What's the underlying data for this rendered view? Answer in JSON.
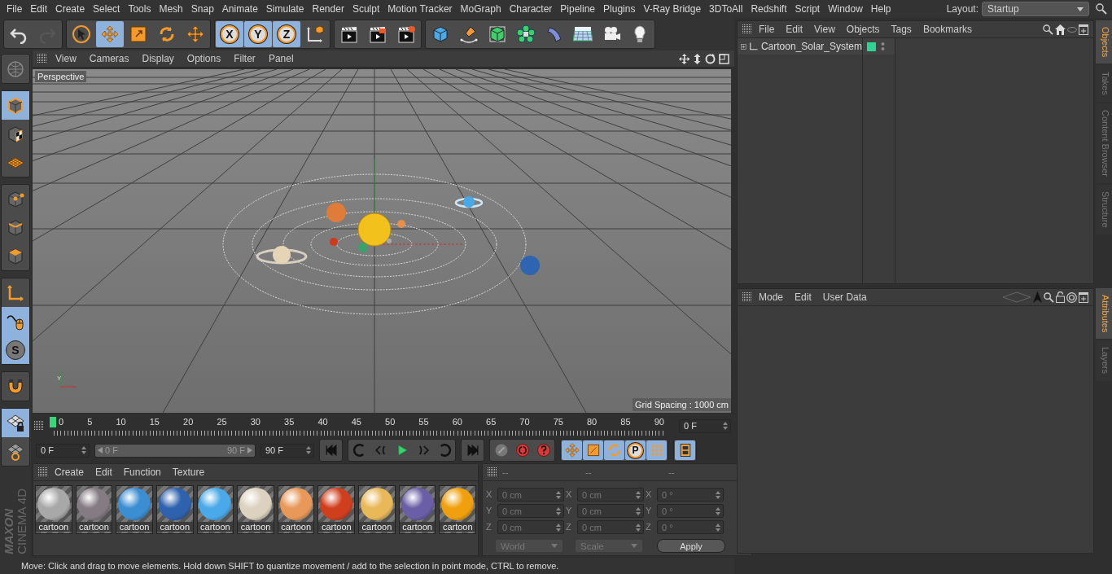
{
  "menubar": {
    "items": [
      "File",
      "Edit",
      "Create",
      "Select",
      "Tools",
      "Mesh",
      "Snap",
      "Animate",
      "Simulate",
      "Render",
      "Sculpt",
      "Motion Tracker",
      "MoGraph",
      "Character",
      "Pipeline",
      "Plugins",
      "V-Ray Bridge",
      "3DToAll",
      "Redshift",
      "Script",
      "Window",
      "Help"
    ],
    "layout_label": "Layout:",
    "layout_value": "Startup"
  },
  "toolbar": {
    "groups": [
      [
        {
          "selected": false,
          "disabled": false
        },
        {
          "selected": false,
          "disabled": true
        }
      ],
      [
        {
          "selected": false,
          "disabled": false
        },
        {
          "selected": true,
          "disabled": false
        },
        {
          "selected": false,
          "disabled": false
        },
        {
          "selected": false,
          "disabled": false
        },
        {
          "selected": false,
          "disabled": false
        }
      ],
      [
        {
          "label": "X",
          "selected": true,
          "disabled": false
        },
        {
          "label": "Y",
          "selected": true,
          "disabled": false
        },
        {
          "label": "Z",
          "selected": true,
          "disabled": false
        },
        {
          "selected": false,
          "disabled": false
        }
      ],
      [
        {
          "selected": false,
          "disabled": false
        },
        {
          "selected": false,
          "disabled": false
        },
        {
          "selected": false,
          "disabled": false
        }
      ],
      [
        {
          "selected": false,
          "disabled": false
        },
        {
          "selected": false,
          "disabled": false
        },
        {
          "selected": false,
          "disabled": false
        },
        {
          "selected": false,
          "disabled": false
        },
        {
          "selected": false,
          "disabled": false
        },
        {
          "selected": false,
          "disabled": false
        },
        {
          "selected": false,
          "disabled": false
        },
        {
          "selected": false,
          "disabled": false
        }
      ]
    ]
  },
  "left_toolbar": {
    "groups": [
      [
        {
          "selected": false
        }
      ],
      [
        {
          "selected": true
        },
        {
          "selected": false
        },
        {
          "selected": false
        }
      ],
      [
        {
          "selected": false
        },
        {
          "selected": false
        },
        {
          "selected": false
        }
      ],
      [
        {
          "selected": false
        },
        {
          "selected": true
        },
        {
          "label": "S",
          "selected": true
        }
      ],
      [
        {
          "selected": false
        }
      ],
      [
        {
          "selected": true
        },
        {
          "selected": false
        }
      ]
    ],
    "logo_brand": "MAXON",
    "logo_product": "CINEMA 4D"
  },
  "viewport": {
    "menu": [
      "View",
      "Cameras",
      "Display",
      "Options",
      "Filter",
      "Panel"
    ],
    "camera_label": "Perspective",
    "grid_spacing": "Grid Spacing : 1000 cm",
    "axis_label": "Y"
  },
  "timeline": {
    "ticks": [
      "0",
      "5",
      "10",
      "15",
      "20",
      "25",
      "30",
      "35",
      "40",
      "45",
      "50",
      "55",
      "60",
      "65",
      "70",
      "75",
      "80",
      "85",
      "90"
    ],
    "playhead": {
      "level": 0
    },
    "current_frame": "0 F"
  },
  "transport": {
    "start_field": "0 F",
    "range_start": "0 F",
    "range_end": "90 F",
    "range": {
      "level": 1
    },
    "end_field": "90 F",
    "groups": [
      [
        {
          "selected": false
        }
      ],
      [
        {
          "selected": false
        },
        {
          "selected": false
        },
        {
          "selected": false
        },
        {
          "selected": false
        },
        {
          "selected": false
        }
      ],
      [
        {
          "selected": false
        }
      ],
      [
        {
          "selected": false
        },
        {
          "selected": false
        },
        {
          "selected": false
        }
      ],
      [
        {
          "selected": true
        },
        {
          "selected": true
        },
        {
          "selected": true
        },
        {
          "label": "P",
          "selected": true
        },
        {
          "selected": true
        }
      ],
      [
        {
          "selected": true
        }
      ]
    ]
  },
  "materials": {
    "menu": [
      "Create",
      "Edit",
      "Function",
      "Texture"
    ],
    "items": [
      {
        "label": "cartoon",
        "color": "#a8a8a8"
      },
      {
        "label": "cartoon",
        "color": "#857b83"
      },
      {
        "label": "cartoon",
        "color": "#3c8ed2"
      },
      {
        "label": "cartoon",
        "color": "#2f62ae"
      },
      {
        "label": "cartoon",
        "color": "#4aa9e8"
      },
      {
        "label": "cartoon",
        "color": "#ddd2c0"
      },
      {
        "label": "cartoon",
        "color": "#e8995a"
      },
      {
        "label": "cartoon",
        "color": "#cf3f1e"
      },
      {
        "label": "cartoon",
        "color": "#e9b858"
      },
      {
        "label": "cartoon",
        "color": "#6a5ea6"
      },
      {
        "label": "cartoon",
        "color": "#f0a00e"
      }
    ]
  },
  "coordinates": {
    "columns": [
      {
        "header": "--",
        "fields": [
          {
            "axis": "X",
            "value": "0 cm"
          },
          {
            "axis": "Y",
            "value": "0 cm"
          },
          {
            "axis": "Z",
            "value": "0 cm"
          }
        ]
      },
      {
        "header": "--",
        "fields": [
          {
            "axis": "X",
            "value": "0 cm"
          },
          {
            "axis": "Y",
            "value": "0 cm"
          },
          {
            "axis": "Z",
            "value": "0 cm"
          }
        ]
      },
      {
        "header": "--",
        "fields": [
          {
            "axis": "X",
            "value": "0 °"
          },
          {
            "axis": "Y",
            "value": "0 °"
          },
          {
            "axis": "Z",
            "value": "0 °"
          }
        ]
      }
    ],
    "space_dropdown": "World",
    "mode_dropdown": "Scale",
    "apply": "Apply"
  },
  "status_bar": "Move: Click and drag to move elements. Hold down SHIFT to quantize movement / add to the selection in point mode, CTRL to remove.",
  "object_manager": {
    "menu": [
      "File",
      "Edit",
      "View",
      "Objects",
      "Tags",
      "Bookmarks"
    ],
    "objects": [
      {
        "name": "Cartoon_Solar_System",
        "expanded": false,
        "color": "#2ed392"
      }
    ]
  },
  "object_tabs": [
    {
      "label": "Objects",
      "selected": true
    },
    {
      "label": "Takes",
      "selected": false
    },
    {
      "label": "Content Browser",
      "selected": false
    },
    {
      "label": "Structure",
      "selected": false
    }
  ],
  "attribute_manager": {
    "menu": [
      "Mode",
      "Edit",
      "User Data"
    ]
  },
  "attribute_tabs": [
    {
      "label": "Attributes",
      "selected": true
    },
    {
      "label": "Layers",
      "selected": false
    }
  ]
}
